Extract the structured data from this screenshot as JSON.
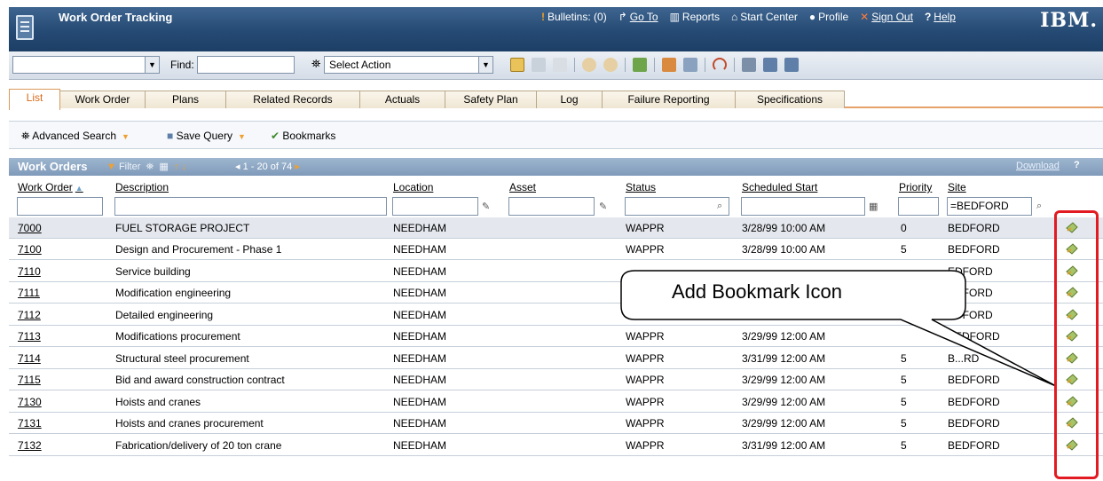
{
  "app": {
    "title": "Work Order Tracking",
    "nav": {
      "bulletins": "Bulletins: (0)",
      "goto": "Go To",
      "reports": "Reports",
      "start_center": "Start Center",
      "profile": "Profile",
      "sign_out": "Sign Out",
      "help": "Help"
    },
    "logo": "IBM."
  },
  "toolbar": {
    "find_label": "Find:",
    "select_action": "Select Action"
  },
  "tabs": [
    "List",
    "Work Order",
    "Plans",
    "Related Records",
    "Actuals",
    "Safety Plan",
    "Log",
    "Failure Reporting",
    "Specifications"
  ],
  "actions": {
    "advanced_search": "Advanced Search",
    "save_query": "Save Query",
    "bookmarks": "Bookmarks"
  },
  "table": {
    "title": "Work Orders",
    "filter": "Filter",
    "count": "1 - 20 of 74",
    "download": "Download",
    "help": "?",
    "columns": {
      "work_order": "Work Order",
      "description": "Description",
      "location": "Location",
      "asset": "Asset",
      "status": "Status",
      "scheduled_start": "Scheduled Start",
      "priority": "Priority",
      "site": "Site"
    },
    "site_filter": "=BEDFORD",
    "rows": [
      {
        "wo": "7000",
        "desc": "FUEL STORAGE PROJECT",
        "loc": "NEEDHAM",
        "status": "WAPPR",
        "start": "3/28/99 10:00 AM",
        "priority": "0",
        "site": "BEDFORD"
      },
      {
        "wo": "7100",
        "desc": "Design and Procurement - Phase 1",
        "loc": "NEEDHAM",
        "status": "WAPPR",
        "start": "3/28/99 10:00 AM",
        "priority": "5",
        "site": "BEDFORD"
      },
      {
        "wo": "7110",
        "desc": "Service building",
        "loc": "NEEDHAM",
        "status": "",
        "start": "",
        "priority": "",
        "site": "EDFORD"
      },
      {
        "wo": "7111",
        "desc": "Modification engineering",
        "loc": "NEEDHAM",
        "status": "",
        "start": "",
        "priority": "",
        "site": "EDFORD"
      },
      {
        "wo": "7112",
        "desc": "Detailed engineering",
        "loc": "NEEDHAM",
        "status": "",
        "start": "",
        "priority": "",
        "site": "EDFORD"
      },
      {
        "wo": "7113",
        "desc": "Modifications procurement",
        "loc": "NEEDHAM",
        "status": "WAPPR",
        "start": "3/29/99 12:00 AM",
        "priority": "",
        "site": "BEDFORD"
      },
      {
        "wo": "7114",
        "desc": "Structural steel procurement",
        "loc": "NEEDHAM",
        "status": "WAPPR",
        "start": "3/31/99 12:00 AM",
        "priority": "5",
        "site": "B...RD"
      },
      {
        "wo": "7115",
        "desc": "Bid and award construction contract",
        "loc": "NEEDHAM",
        "status": "WAPPR",
        "start": "3/29/99 12:00 AM",
        "priority": "5",
        "site": "BEDFORD"
      },
      {
        "wo": "7130",
        "desc": "Hoists and cranes",
        "loc": "NEEDHAM",
        "status": "WAPPR",
        "start": "3/29/99 12:00 AM",
        "priority": "5",
        "site": "BEDFORD"
      },
      {
        "wo": "7131",
        "desc": "Hoists and cranes procurement",
        "loc": "NEEDHAM",
        "status": "WAPPR",
        "start": "3/29/99 12:00 AM",
        "priority": "5",
        "site": "BEDFORD"
      },
      {
        "wo": "7132",
        "desc": "Fabrication/delivery of 20 ton crane",
        "loc": "NEEDHAM",
        "status": "WAPPR",
        "start": "3/31/99 12:00 AM",
        "priority": "5",
        "site": "BEDFORD"
      }
    ]
  },
  "callout": {
    "text": "Add Bookmark Icon"
  }
}
